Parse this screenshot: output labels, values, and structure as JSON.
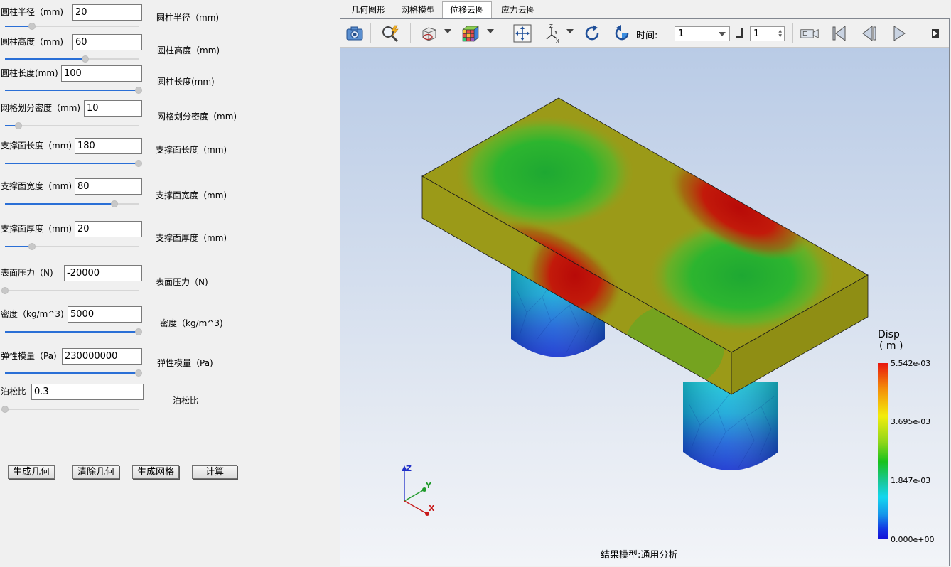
{
  "params": [
    {
      "label": "圆柱半径（mm)",
      "value": "20",
      "side": "圆柱半径（mm)",
      "slider": 0.2
    },
    {
      "label": "圆柱高度（mm)",
      "value": "60",
      "side": "圆柱高度（mm)",
      "slider": 0.6
    },
    {
      "label": "圆柱长度(mm)",
      "value": "100",
      "side": "圆柱长度(mm)",
      "slider": 1.0
    },
    {
      "label": "网格划分密度（mm)",
      "value": "10",
      "side": "网格划分密度（mm)",
      "slider": 0.1
    },
    {
      "label": "支撑面长度（mm)",
      "value": "180",
      "side": "支撑面长度（mm)",
      "slider": 1.0
    },
    {
      "label": "支撑面宽度（mm)",
      "value": "80",
      "side": "支撑面宽度（mm)",
      "slider": 0.82
    },
    {
      "label": "支撑面厚度（mm)",
      "value": "20",
      "side": "支撑面厚度（mm)",
      "slider": 0.2
    },
    {
      "label": "表面压力（N)",
      "value": "-20000",
      "side": "表面压力（N)",
      "slider": 0.0
    },
    {
      "label": "密度（kg/m^3)",
      "value": "5000",
      "side": "密度（kg/m^3)",
      "slider": 1.0
    },
    {
      "label": "弹性模量（Pa)",
      "value": "230000000",
      "side": "弹性模量（Pa)",
      "slider": 1.0
    },
    {
      "label": "泊松比",
      "value": "0.3",
      "side": "泊松比",
      "slider": 0.0
    }
  ],
  "buttons": {
    "gen_geom": "生成几何",
    "clear_geom": "清除几何",
    "gen_mesh": "生成网格",
    "compute": "计算"
  },
  "tabs": [
    "几何图形",
    "网格模型",
    "位移云图",
    "应力云图"
  ],
  "active_tab": 2,
  "toolbar": {
    "time_label": "时间:",
    "time_value": "1",
    "step_value": "1"
  },
  "legend": {
    "title": "Disp",
    "unit": "( m )",
    "ticks": [
      "5.542e-03",
      "3.695e-03",
      "1.847e-03",
      "0.000e+00"
    ]
  },
  "status": "结果模型:通用分析",
  "axes": {
    "z": "Z",
    "y": "Y",
    "x": "X"
  }
}
